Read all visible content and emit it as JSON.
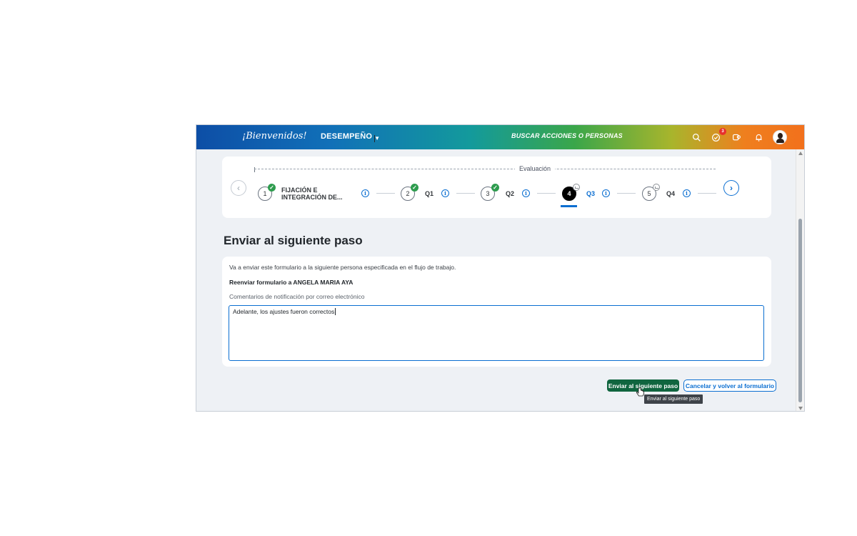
{
  "header": {
    "logo_text": "¡Bienvenidos!",
    "module_label": "DESEMPEÑO",
    "search_placeholder": "BUSCAR ACCIONES O PERSONAS",
    "approvals_badge": "3",
    "icons": [
      "search-icon",
      "approvals-icon",
      "apps-icon",
      "bell-icon",
      "avatar"
    ]
  },
  "stepper": {
    "group_label": "Evaluación",
    "steps": [
      {
        "number": "1",
        "label_line1": "FIJACIÓN E",
        "label_line2": "INTEGRACIÓN DE...",
        "status": "done"
      },
      {
        "number": "2",
        "label": "Q1",
        "status": "done"
      },
      {
        "number": "3",
        "label": "Q2",
        "status": "done"
      },
      {
        "number": "4",
        "label": "Q3",
        "status": "current"
      },
      {
        "number": "5",
        "label": "Q4",
        "status": "pending"
      }
    ]
  },
  "page": {
    "title": "Enviar al siguiente paso"
  },
  "form": {
    "intro": "Va a enviar este formulario a la siguiente persona especificada en el flujo de trabajo.",
    "forward_to": "Reenviar formulario a ANGELA MARIA AYA",
    "comments_label": "Comentarios de notificación por correo electrónico",
    "comments_value": "Adelante, los ajustes fueron correctos"
  },
  "actions": {
    "primary_label": "Enviar al siguiente paso",
    "secondary_label": "Cancelar y volver al formulario",
    "tooltip": "Enviar al siguiente paso"
  },
  "colors": {
    "primary_button": "#10653f",
    "accent": "#0a6ed1",
    "check": "#2e9c4e",
    "badge": "#e8302d"
  }
}
